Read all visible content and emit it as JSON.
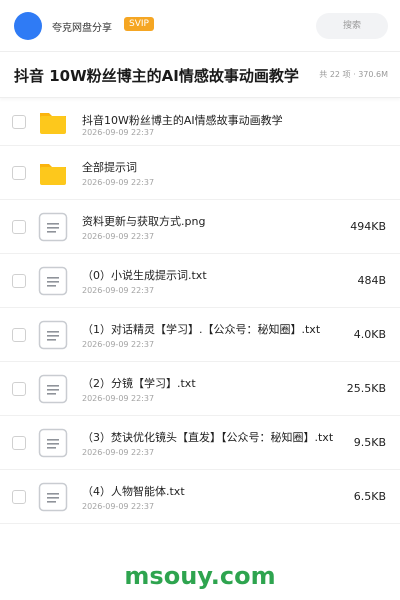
{
  "header": {
    "site_name": "夸克网盘分享",
    "badge": "SVIP",
    "search_placeholder": "搜索",
    "avatar_color": "#2f7bf5"
  },
  "folder": {
    "title": "抖音 10W粉丝博主的AI情感故事动画教学",
    "meta": "共 22 项 · 370.6M"
  },
  "items": [
    {
      "name": "抖音10W粉丝博主的AI情感故事动画教学",
      "date": "2026-09-09 22:37",
      "size": "",
      "type": "folder-icon"
    },
    {
      "name": "全部提示词",
      "date": "2026-09-09 22:37",
      "size": "",
      "type": "folder-icon"
    },
    {
      "name": "资料更新与获取方式.png",
      "date": "2026-09-09 22:37",
      "size": "494KB",
      "type": "document-icon"
    },
    {
      "name": "（0）小说生成提示词.txt",
      "date": "2026-09-09 22:37",
      "size": "484B",
      "type": "document-icon"
    },
    {
      "name": "（1）对话精灵【学习】.【公众号：秘知圈】.txt",
      "date": "2026-09-09 22:37",
      "size": "4.0KB",
      "type": "document-icon"
    },
    {
      "name": "（2）分镜【学习】.txt",
      "date": "2026-09-09 22:37",
      "size": "25.5KB",
      "type": "document-icon"
    },
    {
      "name": "（3）焚诀优化镜头【直发】【公众号：秘知圈】.txt",
      "date": "2026-09-09 22:37",
      "size": "9.5KB",
      "type": "document-icon"
    },
    {
      "name": "（4）人物智能体.txt",
      "date": "2026-09-09 22:37",
      "size": "6.5KB",
      "type": "document-icon"
    }
  ],
  "watermark": "msouy.com",
  "colors": {
    "folder_body": "#fdc81c",
    "folder_tab": "#fbb40e",
    "doc_border": "#c9ccd1",
    "doc_lines": "#8f939a",
    "watermark": "#2ea44f",
    "svip": "#f5a623"
  }
}
